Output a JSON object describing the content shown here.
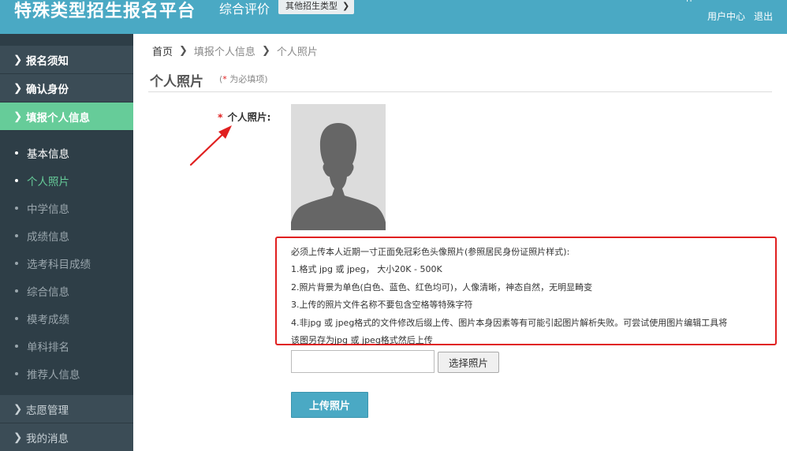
{
  "header": {
    "site_title": "特殊类型招生报名平台",
    "section_title": "综合评价",
    "other_type_label": "其他招生类型",
    "user_center": "用户中心",
    "logout": "退出",
    "user_fragment": "IT"
  },
  "sidebar": {
    "main_items": [
      {
        "label": "报名须知"
      },
      {
        "label": "确认身份"
      },
      {
        "label": "填报个人信息"
      }
    ],
    "sub_items": [
      {
        "label": "基本信息"
      },
      {
        "label": "个人照片"
      },
      {
        "label": "中学信息"
      },
      {
        "label": "成绩信息"
      },
      {
        "label": "选考科目成绩"
      },
      {
        "label": "综合信息"
      },
      {
        "label": "模考成绩"
      },
      {
        "label": "单科排名"
      },
      {
        "label": "推荐人信息"
      }
    ],
    "bottom_items": [
      {
        "label": "志愿管理"
      },
      {
        "label": "我的消息"
      }
    ]
  },
  "breadcrumb": {
    "items": [
      "首页",
      "填报个人信息",
      "个人照片"
    ]
  },
  "page": {
    "title": "个人照片",
    "required_star": "*",
    "required_note": "为必填项",
    "required_open": "(",
    "required_close": ")"
  },
  "form": {
    "photo_label": "个人照片:",
    "requirements": [
      "必须上传本人近期一寸正面免冠彩色头像照片(参照居民身份证照片样式):",
      "1.格式 jpg 或 jpeg， 大小20K - 500K",
      "2.照片背景为单色(白色、蓝色、红色均可)，人像清晰，神态自然，无明显畸变",
      "3.上传的照片文件名称不要包含空格等特殊字符",
      "4.非jpg 或 jpeg格式的文件修改后缀上传、图片本身因素等有可能引起图片解析失败。可尝试使用图片编辑工具将",
      "该图另存为jpg 或 jpeg格式然后上传"
    ],
    "file_input_value": "",
    "choose_label": "选择照片",
    "upload_label": "上传照片"
  },
  "colors": {
    "header": "#4aa9c4",
    "sidebar": "#2e3e47",
    "active": "#66cc99",
    "alert": "#e02020"
  }
}
